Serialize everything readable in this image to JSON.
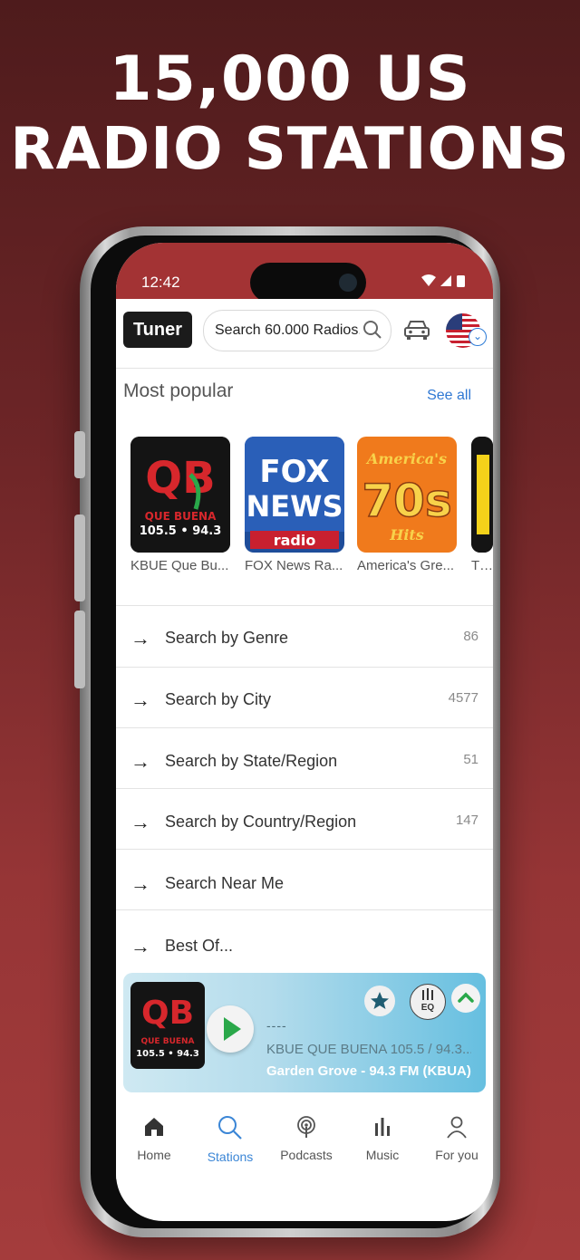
{
  "promo": {
    "line1": "15,000 US",
    "line2": "RADIO STATIONS"
  },
  "status": {
    "time": "12:42"
  },
  "header": {
    "logo_text": "Tuner",
    "search_placeholder": "Search 60.000 Radios..."
  },
  "most_popular": {
    "title": "Most popular",
    "see_all": "See all",
    "stations": [
      {
        "label": "KBUE Que Bu...",
        "logo_line1": "QB",
        "logo_line2": "QUE BUENA",
        "logo_line3": "105.5 • 94.3"
      },
      {
        "label": "FOX News Ra...",
        "logo_line1": "FOX",
        "logo_line2": "NEWS",
        "logo_line3": "radio"
      },
      {
        "label": "America's Gre...",
        "logo_line1": "America's",
        "logo_line2": "70s",
        "logo_line3": "Hits"
      },
      {
        "label": "The",
        "logo_line1": ""
      }
    ]
  },
  "menu": [
    {
      "label": "Search by Genre",
      "count": "86"
    },
    {
      "label": "Search by City",
      "count": "4577"
    },
    {
      "label": "Search by State/Region",
      "count": "51"
    },
    {
      "label": "Search by Country/Region",
      "count": "147"
    },
    {
      "label": "Search Near Me",
      "count": ""
    },
    {
      "label": "Best Of...",
      "count": ""
    }
  ],
  "player": {
    "dash": "----",
    "title": "KBUE QUE BUENA 105.5 / 94.3...",
    "subtitle": "Garden Grove - 94.3 FM (KBUA)",
    "eq_label": "EQ"
  },
  "nav": [
    {
      "label": "Home",
      "icon": "home-icon"
    },
    {
      "label": "Stations",
      "icon": "search-icon",
      "active": true
    },
    {
      "label": "Podcasts",
      "icon": "podcast-icon"
    },
    {
      "label": "Music",
      "icon": "music-bars-icon"
    },
    {
      "label": "For you",
      "icon": "person-icon"
    }
  ],
  "colors": {
    "brand_red": "#a33334",
    "accent_blue": "#3b86d6",
    "player_gradient_end": "#66bfe0"
  }
}
